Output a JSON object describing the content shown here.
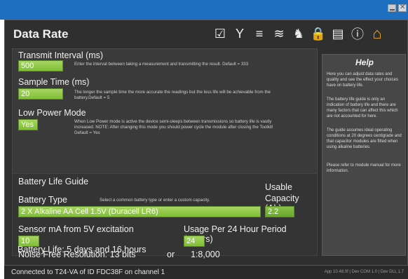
{
  "window": {
    "min_icon": "minimize-icon",
    "close_icon": "close-icon"
  },
  "header": {
    "title": "Data Rate"
  },
  "toolbar": {
    "icons": [
      "checklist-icon",
      "antenna-icon",
      "signal-icon",
      "wireless-icon",
      "user-key-icon",
      "lock-icon",
      "database-icon",
      "info-icon",
      "home-icon"
    ]
  },
  "form": {
    "transmit_label": "Transmit Interval (ms)",
    "transmit_value": "500",
    "transmit_desc": "Enter the interval between taking a measurement and transmitting the result. Default = 333",
    "sample_label": "Sample Time (ms)",
    "sample_value": "20",
    "sample_desc": "The longer the sample time the more accurate the readings but the less life will be achievable from the battery.Default = 5",
    "lowpower_label": "Low Power Mode",
    "lowpower_value": "Yes",
    "lowpower_desc": "When Low Power mode is active the device semi-sleeps between transmissions so battery life is vastly increased. NOTE: After changing this mode you should power cycle the module after closing the Toolkit! Default = Yes"
  },
  "battery": {
    "guide_label": "Battery Life Guide",
    "type_label": "Battery Type",
    "type_hint": "Select a common battery type or enter a custom capacity.",
    "type_value": "2 X Alkaline AA Cell 1.5V (Duracell LR6)",
    "usable_label": "Usable",
    "capacity_label": "Capacity (Ah)",
    "capacity_value": "2.2",
    "sensor_label": "Sensor mA from 5V excitation",
    "sensor_value": "10",
    "usage_label": "Usage Per 24 Hour Period (Hours)",
    "usage_value": "24",
    "resolution_text": "Noise Free Resolution: 13 bits",
    "or_text": "or",
    "ratio_text": "1:8,000",
    "life_text": "Battery Life: 5 days and 16 hours"
  },
  "help": {
    "title": "Help",
    "p1": "Here you can adjust data rates and quality and see the effect your choices have on battery life.",
    "p2": "The battery life guide is only an indication of battery life and there are many factors that can affect this which are not accounted for here.",
    "p3": "The guide assumes ideal operating conditions at 20 degrees centigrade and that capacitor modules are fitted when using alkaline batteries.",
    "p4": "Please refer to module manual for more information."
  },
  "status": {
    "text": "Connected to T24-VA of ID FDC38F on channel 1",
    "version": "App 10.48.0f | Dev COM 1.0 | Dev DLL 1.7"
  }
}
